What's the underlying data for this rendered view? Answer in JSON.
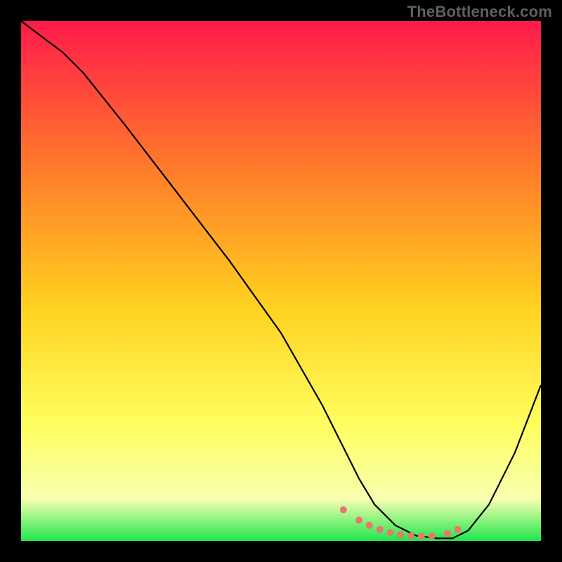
{
  "watermark": "TheBottleneck.com",
  "colors": {
    "frame": "#000000",
    "grad_top": "#ff1a4b",
    "grad_mid_upper": "#ff7a2a",
    "grad_mid": "#ffd21f",
    "grad_mid_lower": "#ffff60",
    "grad_lower": "#f7ffb0",
    "grad_bottom": "#1ee64b",
    "curve": "#000000",
    "markers": "#e9776e"
  },
  "chart_data": {
    "type": "line",
    "title": "",
    "xlabel": "",
    "ylabel": "",
    "xlim": [
      0,
      100
    ],
    "ylim": [
      0,
      100
    ],
    "curve": {
      "name": "bottleneck-curve",
      "x": [
        0,
        4,
        8,
        12,
        20,
        30,
        40,
        50,
        58,
        62,
        65,
        68,
        72,
        76,
        80,
        83,
        86,
        90,
        95,
        100
      ],
      "y": [
        100,
        97,
        94,
        90,
        80,
        67,
        54,
        40,
        26,
        18,
        12,
        7,
        3,
        1,
        0.5,
        0.5,
        2,
        7,
        17,
        30
      ]
    },
    "markers": {
      "name": "optimal-range",
      "x": [
        62,
        65,
        67,
        69,
        71,
        73,
        75,
        77,
        79,
        82,
        84
      ],
      "y": [
        6,
        4,
        3,
        2.2,
        1.6,
        1.2,
        1,
        0.9,
        0.9,
        1.4,
        2.2
      ]
    }
  }
}
